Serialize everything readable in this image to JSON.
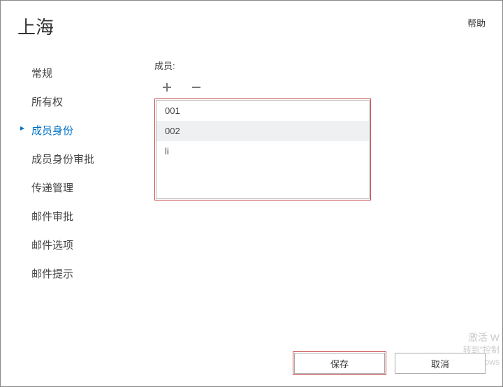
{
  "header": {
    "title": "上海",
    "help": "帮助"
  },
  "sidebar": {
    "items": [
      {
        "label": "常规"
      },
      {
        "label": "所有权"
      },
      {
        "label": "成员身份"
      },
      {
        "label": "成员身份审批"
      },
      {
        "label": "传递管理"
      },
      {
        "label": "邮件审批"
      },
      {
        "label": "邮件选项"
      },
      {
        "label": "邮件提示"
      }
    ],
    "active_index": 2
  },
  "main": {
    "members_label": "成员:",
    "members": [
      {
        "name": "001"
      },
      {
        "name": "002"
      },
      {
        "name": "li"
      }
    ]
  },
  "footer": {
    "save": "保存",
    "cancel": "取消"
  },
  "watermark": {
    "line1": "激活 W",
    "line2": "转到\"控制",
    "line3": "Windows"
  }
}
